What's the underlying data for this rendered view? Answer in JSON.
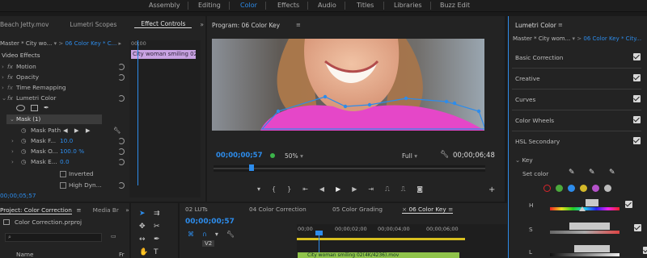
{
  "workspaces": [
    "Assembly",
    "Editing",
    "Color",
    "Effects",
    "Audio",
    "Titles",
    "Libraries",
    "Buzz Edit"
  ],
  "active_workspace": "Color",
  "left_panel": {
    "tabs": [
      "Beach Jetty.mov",
      "Lumetri Scopes",
      "Effect Controls"
    ],
    "source_label": "Master * City wo...",
    "sequence_label": "06 Color Key * C...",
    "clip_label": "City woman smiling 02",
    "section_title": "Video Effects",
    "effects": {
      "motion": "Motion",
      "opacity": "Opacity",
      "time_remapping": "Time Remapping",
      "lumetri": "Lumetri Color",
      "mask": "Mask (1)",
      "mask_path": "Mask Path",
      "mask_feather": "Mask F...",
      "mask_feather_val": "10.0",
      "mask_opacity": "Mask O...",
      "mask_opacity_val": "100.0 %",
      "mask_expansion": "Mask E...",
      "mask_expansion_val": "0.0",
      "inverted": "Inverted",
      "high_dyn": "High Dyn..."
    },
    "timecode": "00;00;05;57",
    "ruler_start": "00;00"
  },
  "program": {
    "title": "Program: 06 Color Key",
    "timecode_left": "00;00;00;57",
    "zoom": "50%",
    "quality": "Full",
    "timecode_right": "00;00;06;48"
  },
  "lumetri": {
    "title": "Lumetri Color",
    "source_label": "Master * City wom...",
    "sequence_label": "06 Color Key * City...",
    "sections": [
      "Basic Correction",
      "Creative",
      "Curves",
      "Color Wheels",
      "HSL Secondary"
    ],
    "key_label": "Key",
    "set_color": "Set color",
    "channels": [
      "H",
      "S",
      "L"
    ],
    "swatches": [
      "#d8252b",
      "#4caa3c",
      "#2d8ceb",
      "#d3b829",
      "#b452c9",
      "#bcbcbc"
    ]
  },
  "project": {
    "tab": "Project: Color Correction",
    "tab2": "Media Br",
    "file": "Color Correction.prproj",
    "col_name": "Name",
    "col_fr": "Fr"
  },
  "timeline": {
    "tabs": [
      "02 LUTs",
      "04 Color Correction",
      "05 Color Grading",
      "06 Color Key"
    ],
    "timecode": "00;00;00;57",
    "ruler": [
      "00;00",
      "00;00;02;00",
      "00;00;04;00",
      "00;00;06;00"
    ],
    "track": "V2",
    "clip": "City woman smiling 02(4K/4236).mov"
  }
}
